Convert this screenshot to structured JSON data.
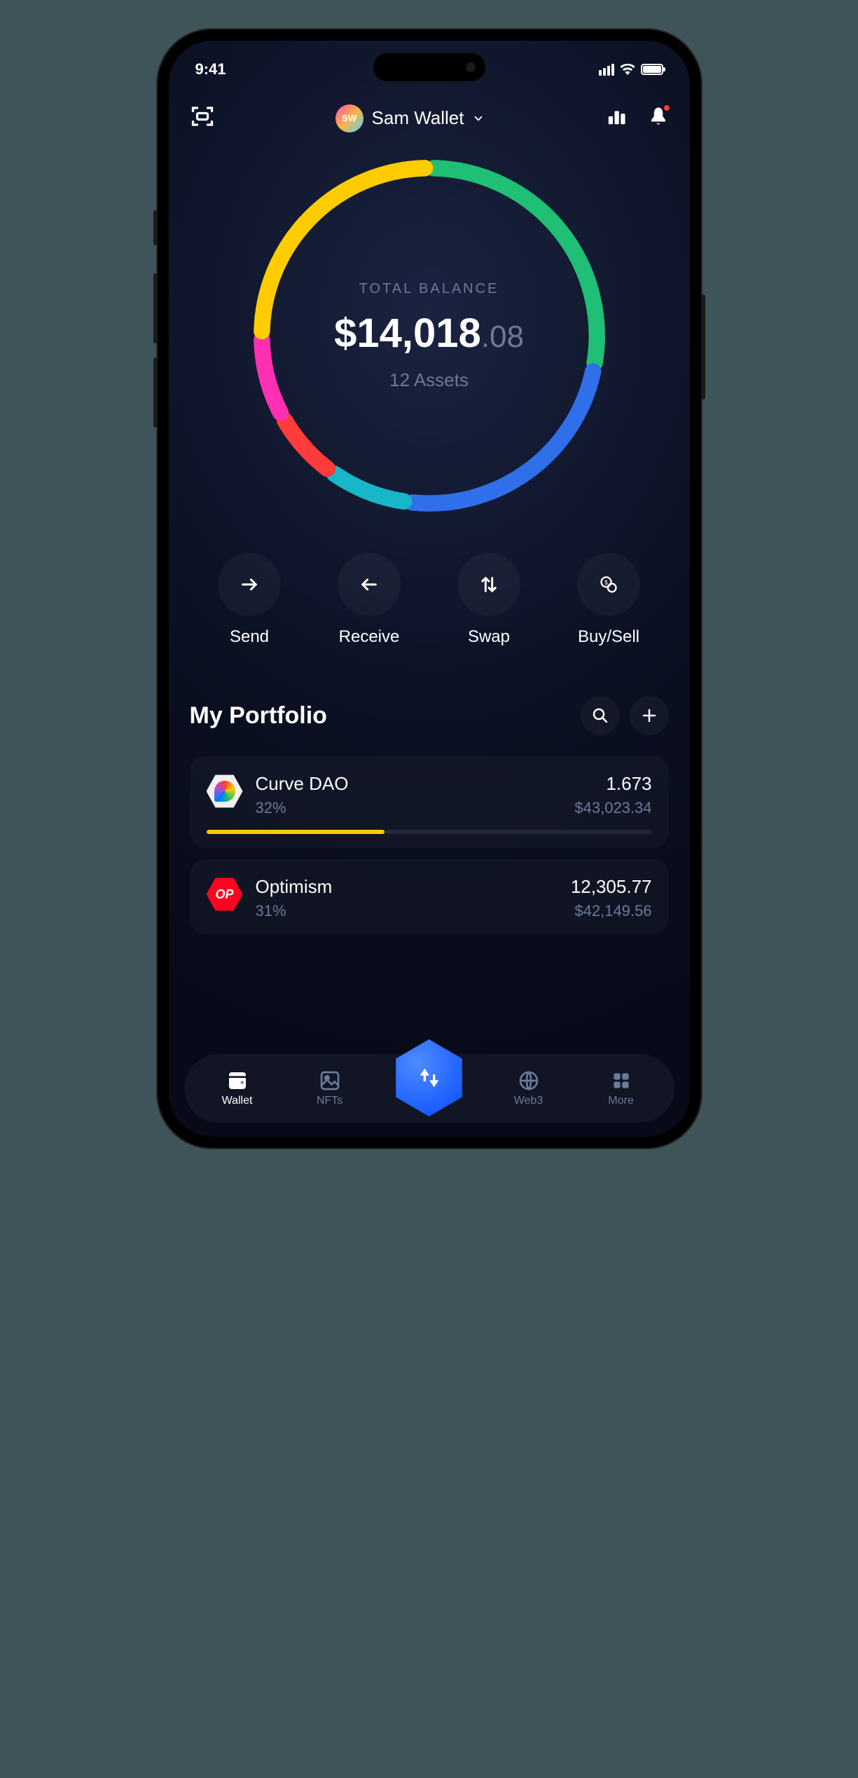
{
  "status": {
    "time": "9:41"
  },
  "header": {
    "avatar_initials": "SW",
    "wallet_name": "Sam Wallet"
  },
  "balance": {
    "label": "TOTAL BALANCE",
    "currency_symbol": "$",
    "major": "14,018",
    "minor": ".08",
    "asset_count_text": "12 Assets"
  },
  "chart_data": {
    "type": "pie",
    "title": "Portfolio allocation ring",
    "series": [
      {
        "name": "segment-green",
        "value": 28,
        "color": "#1fbf75"
      },
      {
        "name": "segment-blue",
        "value": 24,
        "color": "#2f6fea"
      },
      {
        "name": "segment-cyan",
        "value": 8,
        "color": "#17b7c9"
      },
      {
        "name": "segment-red",
        "value": 7,
        "color": "#ff3b3b"
      },
      {
        "name": "segment-magenta",
        "value": 8,
        "color": "#ff2fb3"
      },
      {
        "name": "segment-yellow",
        "value": 25,
        "color": "#ffcc00"
      }
    ]
  },
  "actions": {
    "send": "Send",
    "receive": "Receive",
    "swap": "Swap",
    "buysell": "Buy/Sell"
  },
  "portfolio": {
    "title": "My Portfolio",
    "assets": [
      {
        "name": "Curve DAO",
        "pct": "32%",
        "qty": "1.673",
        "usd": "$43,023.34",
        "bar_pct": 40,
        "bar_color": "#ffcc00",
        "icon": "curve"
      },
      {
        "name": "Optimism",
        "pct": "31%",
        "qty": "12,305.77",
        "usd": "$42,149.56",
        "bar_pct": 0,
        "bar_color": "#ff0420",
        "icon": "optimism",
        "icon_text": "OP"
      }
    ]
  },
  "nav": {
    "wallet": "Wallet",
    "nfts": "NFTs",
    "web3": "Web3",
    "more": "More"
  }
}
